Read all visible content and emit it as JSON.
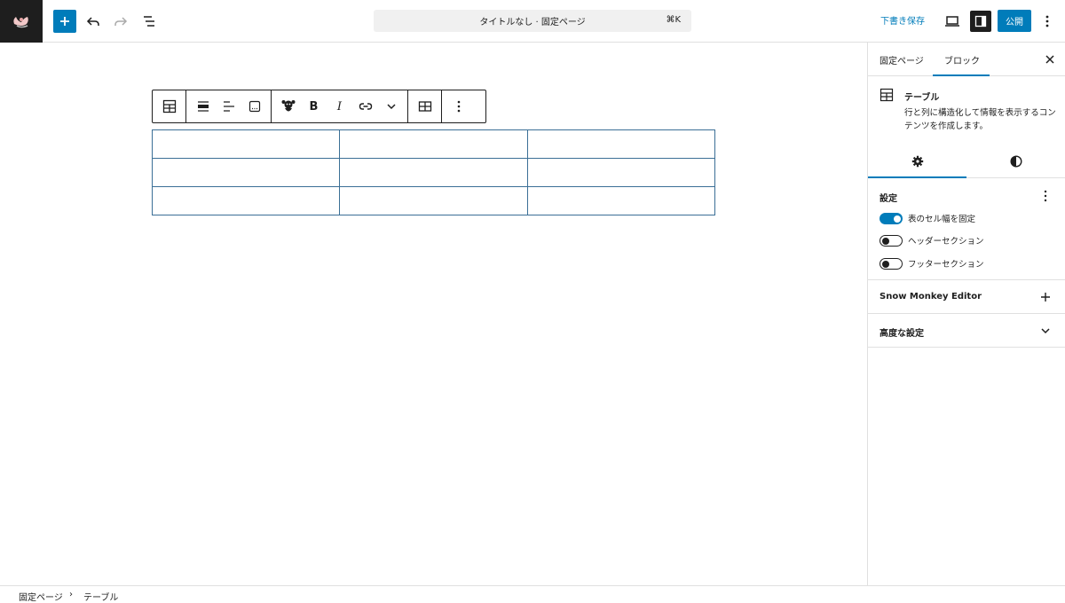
{
  "topbar": {
    "add_block_label": "+",
    "document_title": "タイトルなし · 固定ページ",
    "shortcut": "⌘K",
    "save_draft_label": "下書き保存",
    "publish_label": "公開",
    "icons": [
      "site-logo-icon",
      "plus-icon",
      "undo-icon",
      "redo-icon",
      "list-view-icon",
      "desktop-preview-icon",
      "sidebar-toggle-icon",
      "more-vertical-icon"
    ]
  },
  "block_toolbar": {
    "icons": [
      "table-icon",
      "align-wide-icon",
      "align-left-icon",
      "caption-icon",
      "snow-monkey-icon",
      "bold-icon",
      "italic-icon",
      "link-icon",
      "chevron-down-icon",
      "table-edit-icon",
      "more-vertical-icon"
    ],
    "bold_label": "B",
    "italic_label": "I"
  },
  "table": {
    "rows": 3,
    "cols": 3,
    "cells": [
      [
        "",
        "",
        ""
      ],
      [
        "",
        "",
        ""
      ],
      [
        "",
        "",
        ""
      ]
    ]
  },
  "sidebar": {
    "tabs": [
      {
        "label": "固定ページ",
        "active": false
      },
      {
        "label": "ブロック",
        "active": true
      }
    ],
    "block_card": {
      "title": "テーブル",
      "description": "行と列に構造化して情報を表示するコンテンツを作成します。"
    },
    "sub_tabs": [
      "settings-gear-icon",
      "styles-contrast-icon"
    ],
    "settings": {
      "title": "設定",
      "toggles": [
        {
          "label": "表のセル幅を固定",
          "checked": true
        },
        {
          "label": "ヘッダーセクション",
          "checked": false
        },
        {
          "label": "フッターセクション",
          "checked": false
        }
      ]
    },
    "panels": [
      {
        "label": "Snow Monkey Editor",
        "icon": "plus-icon"
      },
      {
        "label": "高度な設定",
        "icon": "chevron-down-icon"
      }
    ]
  },
  "breadcrumb": {
    "items": [
      "固定ページ",
      "テーブル"
    ],
    "separator": "›"
  },
  "colors": {
    "accent": "#007cba",
    "dark": "#1e1e1e",
    "border": "#e0e0e0"
  }
}
